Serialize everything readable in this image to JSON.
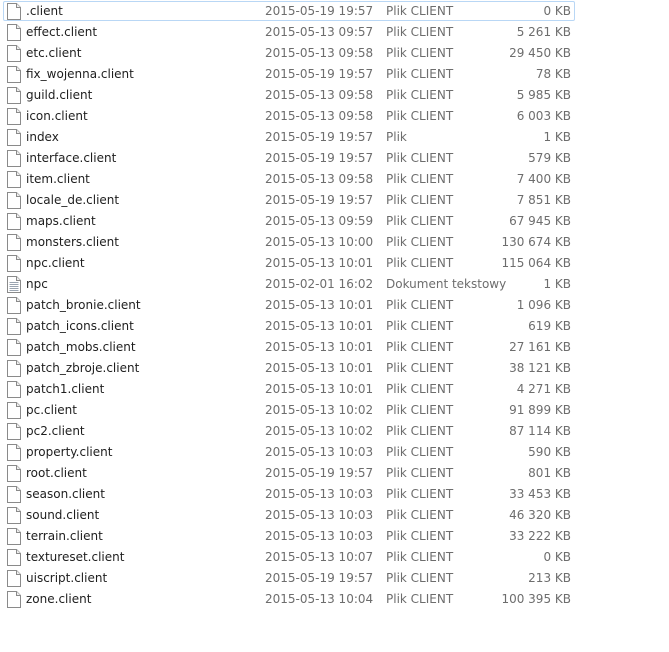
{
  "files": [
    {
      "name": ".client",
      "date": "2015-05-19 19:57",
      "type": "Plik CLIENT",
      "size": "0 KB",
      "icon": "blank-file-icon"
    },
    {
      "name": "effect.client",
      "date": "2015-05-13 09:57",
      "type": "Plik CLIENT",
      "size": "5 261 KB",
      "icon": "blank-file-icon"
    },
    {
      "name": "etc.client",
      "date": "2015-05-13 09:58",
      "type": "Plik CLIENT",
      "size": "29 450 KB",
      "icon": "blank-file-icon"
    },
    {
      "name": "fix_wojenna.client",
      "date": "2015-05-19 19:57",
      "type": "Plik CLIENT",
      "size": "78 KB",
      "icon": "blank-file-icon"
    },
    {
      "name": "guild.client",
      "date": "2015-05-13 09:58",
      "type": "Plik CLIENT",
      "size": "5 985 KB",
      "icon": "blank-file-icon"
    },
    {
      "name": "icon.client",
      "date": "2015-05-13 09:58",
      "type": "Plik CLIENT",
      "size": "6 003 KB",
      "icon": "blank-file-icon"
    },
    {
      "name": "index",
      "date": "2015-05-19 19:57",
      "type": "Plik",
      "size": "1 KB",
      "icon": "blank-file-icon"
    },
    {
      "name": "interface.client",
      "date": "2015-05-19 19:57",
      "type": "Plik CLIENT",
      "size": "579 KB",
      "icon": "blank-file-icon"
    },
    {
      "name": "item.client",
      "date": "2015-05-13 09:58",
      "type": "Plik CLIENT",
      "size": "7 400 KB",
      "icon": "blank-file-icon"
    },
    {
      "name": "locale_de.client",
      "date": "2015-05-19 19:57",
      "type": "Plik CLIENT",
      "size": "7 851 KB",
      "icon": "blank-file-icon"
    },
    {
      "name": "maps.client",
      "date": "2015-05-13 09:59",
      "type": "Plik CLIENT",
      "size": "67 945 KB",
      "icon": "blank-file-icon"
    },
    {
      "name": "monsters.client",
      "date": "2015-05-13 10:00",
      "type": "Plik CLIENT",
      "size": "130 674 KB",
      "icon": "blank-file-icon"
    },
    {
      "name": "npc.client",
      "date": "2015-05-13 10:01",
      "type": "Plik CLIENT",
      "size": "115 064 KB",
      "icon": "blank-file-icon"
    },
    {
      "name": "npc",
      "date": "2015-02-01 16:02",
      "type": "Dokument tekstowy",
      "size": "1 KB",
      "icon": "text-document-icon"
    },
    {
      "name": "patch_bronie.client",
      "date": "2015-05-13 10:01",
      "type": "Plik CLIENT",
      "size": "1 096 KB",
      "icon": "blank-file-icon"
    },
    {
      "name": "patch_icons.client",
      "date": "2015-05-13 10:01",
      "type": "Plik CLIENT",
      "size": "619 KB",
      "icon": "blank-file-icon"
    },
    {
      "name": "patch_mobs.client",
      "date": "2015-05-13 10:01",
      "type": "Plik CLIENT",
      "size": "27 161 KB",
      "icon": "blank-file-icon"
    },
    {
      "name": "patch_zbroje.client",
      "date": "2015-05-13 10:01",
      "type": "Plik CLIENT",
      "size": "38 121 KB",
      "icon": "blank-file-icon"
    },
    {
      "name": "patch1.client",
      "date": "2015-05-13 10:01",
      "type": "Plik CLIENT",
      "size": "4 271 KB",
      "icon": "blank-file-icon"
    },
    {
      "name": "pc.client",
      "date": "2015-05-13 10:02",
      "type": "Plik CLIENT",
      "size": "91 899 KB",
      "icon": "blank-file-icon"
    },
    {
      "name": "pc2.client",
      "date": "2015-05-13 10:02",
      "type": "Plik CLIENT",
      "size": "87 114 KB",
      "icon": "blank-file-icon"
    },
    {
      "name": "property.client",
      "date": "2015-05-13 10:03",
      "type": "Plik CLIENT",
      "size": "590 KB",
      "icon": "blank-file-icon"
    },
    {
      "name": "root.client",
      "date": "2015-05-19 19:57",
      "type": "Plik CLIENT",
      "size": "801 KB",
      "icon": "blank-file-icon"
    },
    {
      "name": "season.client",
      "date": "2015-05-13 10:03",
      "type": "Plik CLIENT",
      "size": "33 453 KB",
      "icon": "blank-file-icon"
    },
    {
      "name": "sound.client",
      "date": "2015-05-13 10:03",
      "type": "Plik CLIENT",
      "size": "46 320 KB",
      "icon": "blank-file-icon"
    },
    {
      "name": "terrain.client",
      "date": "2015-05-13 10:03",
      "type": "Plik CLIENT",
      "size": "33 222 KB",
      "icon": "blank-file-icon"
    },
    {
      "name": "textureset.client",
      "date": "2015-05-13 10:07",
      "type": "Plik CLIENT",
      "size": "0 KB",
      "icon": "blank-file-icon"
    },
    {
      "name": "uiscript.client",
      "date": "2015-05-19 19:57",
      "type": "Plik CLIENT",
      "size": "213 KB",
      "icon": "blank-file-icon"
    },
    {
      "name": "zone.client",
      "date": "2015-05-13 10:04",
      "type": "Plik CLIENT",
      "size": "100 395 KB",
      "icon": "blank-file-icon"
    }
  ],
  "selected_index": 0,
  "colors": {
    "selection_border": "#b9d7f5",
    "name_text": "#1e1e1e",
    "detail_text": "#6d6d6d"
  }
}
